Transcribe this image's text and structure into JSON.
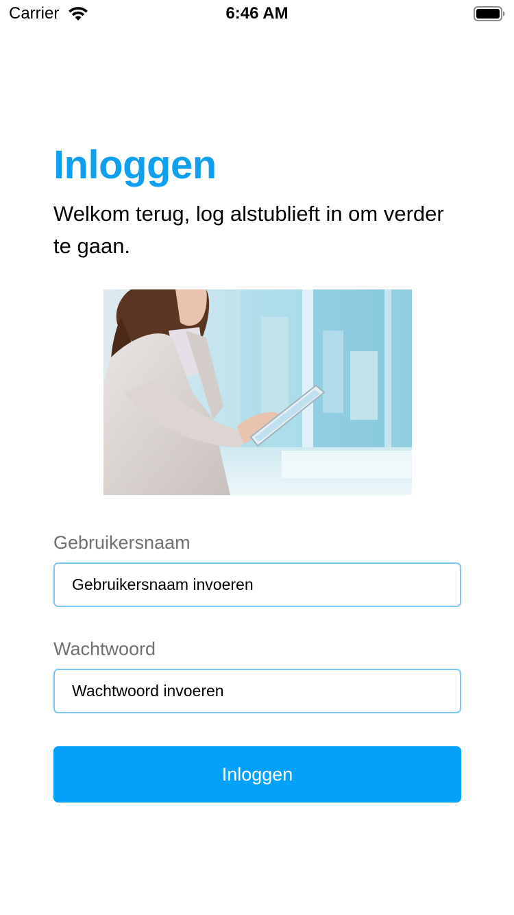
{
  "status_bar": {
    "carrier": "Carrier",
    "time": "6:46 AM",
    "wifi_icon": "wifi-icon",
    "battery_icon": "battery-icon"
  },
  "login": {
    "title": "Inloggen",
    "subtitle": "Welkom terug, log alstublieft in om verder te gaan.",
    "username": {
      "label": "Gebruikersnaam",
      "placeholder": "Gebruikersnaam invoeren",
      "value": ""
    },
    "password": {
      "label": "Wachtwoord",
      "placeholder": "Wachtwoord invoeren",
      "value": ""
    },
    "submit_label": "Inloggen"
  },
  "colors": {
    "accent": "#0ea0ef",
    "button": "#03a1fa",
    "field_border": "#7cc6f2",
    "label_gray": "#707070"
  }
}
